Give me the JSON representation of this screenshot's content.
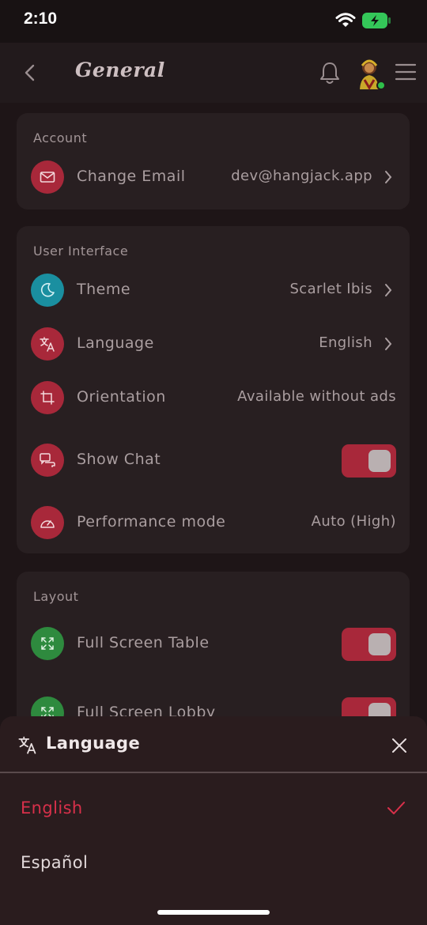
{
  "status": {
    "time": "2:10"
  },
  "header": {
    "title": "General"
  },
  "account": {
    "title": "Account",
    "change_email": {
      "label": "Change Email",
      "value": "dev@hangjack.app"
    }
  },
  "ui": {
    "title": "User Interface",
    "theme": {
      "label": "Theme",
      "value": "Scarlet Ibis"
    },
    "language": {
      "label": "Language",
      "value": "English"
    },
    "orientation": {
      "label": "Orientation",
      "value": "Available without ads"
    },
    "show_chat": {
      "label": "Show Chat",
      "on": true
    },
    "performance": {
      "label": "Performance mode",
      "value": "Auto (High)"
    }
  },
  "layout": {
    "title": "Layout",
    "full_screen_table": {
      "label": "Full Screen Table",
      "on": true
    },
    "full_screen_lobby": {
      "label": "Full Screen Lobby",
      "on": true
    }
  },
  "language_sheet": {
    "title": "Language",
    "options": [
      {
        "label": "English",
        "selected": true
      },
      {
        "label": "Español",
        "selected": false
      }
    ]
  },
  "colors": {
    "accent_red": "#d8304a",
    "icon_red": "#a8283a",
    "icon_teal": "#1a8fa0",
    "icon_green": "#2e8a3e"
  },
  "icons": {
    "email": "envelope-icon",
    "theme": "moon-icon",
    "language": "translate-icon",
    "orientation": "rotate-icon",
    "chat": "chat-icon",
    "performance": "gauge-icon",
    "fullscreen": "expand-icon"
  }
}
